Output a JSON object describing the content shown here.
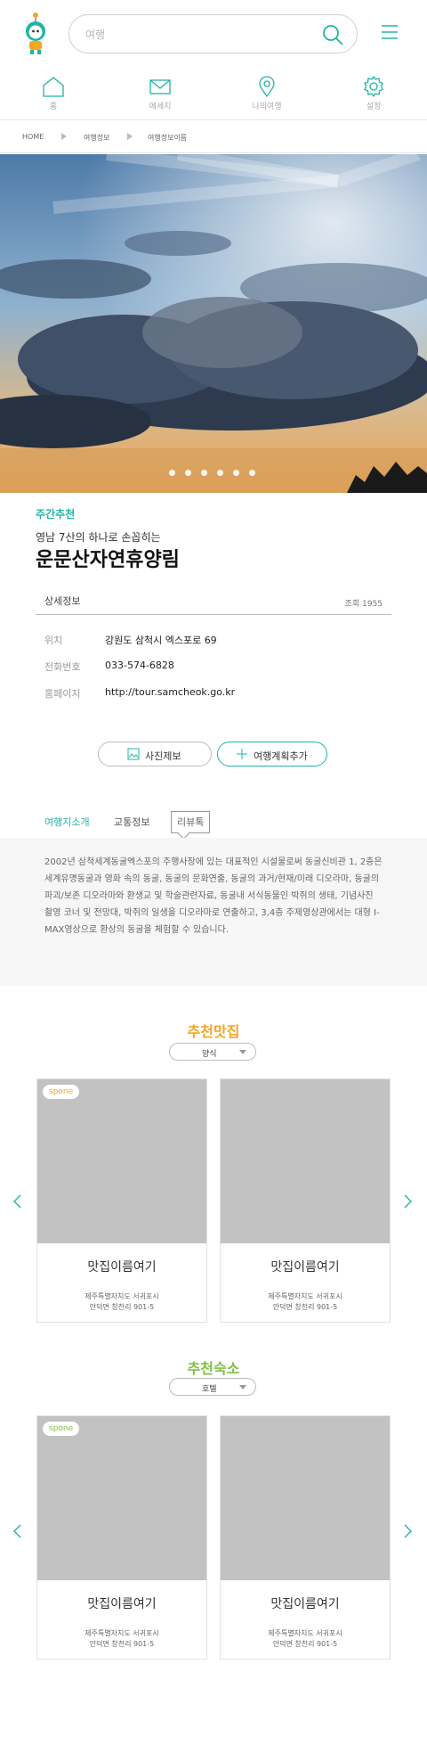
{
  "header": {
    "search_placeholder": "여행",
    "icons": {
      "mascot": "mascot-icon",
      "search": "search-icon",
      "menu": "menu-icon"
    }
  },
  "nav": [
    {
      "label": "홈",
      "icon": "home-icon"
    },
    {
      "label": "메세지",
      "icon": "mail-icon"
    },
    {
      "label": "나의여행",
      "icon": "location-pin-icon"
    },
    {
      "label": "설정",
      "icon": "gear-icon"
    }
  ],
  "breadcrumb": [
    "HOME",
    "여행정보",
    "여행정보이름"
  ],
  "hero": {
    "slide_count": 6,
    "active_slide": 0
  },
  "info": {
    "tag": "주간추천",
    "subtitle": "영남 7산의 하나로 손꼽히는",
    "title": "운문산자연휴양림",
    "detail_label": "상세정보",
    "views": "조회 1955",
    "rows": [
      {
        "key": "위치",
        "value": "강원도 삼척시 엑스포로 69"
      },
      {
        "key": "전화번호",
        "value": "033-574-6828"
      },
      {
        "key": "홈페이지",
        "value": "http://tour.samcheok.go.kr"
      }
    ]
  },
  "buttons": {
    "photo": "사진제보",
    "plan": "여행계획추가"
  },
  "tabs": [
    "여행지소개",
    "교통정보",
    "리뷰톡"
  ],
  "description": "2002년 삼척세계동굴엑스포의 주행사장에 있는 대표적인 시설물로써 동굴신비관 1, 2층은 세계유명동굴과 영화 속의 동굴, 동굴의 문화연출, 동굴의 과거/현재/미래 디오라마, 동굴의 파괴/보존 디오라마와 환생교 및 학술관련자료, 동굴내 서식동물인 박쥐의 생태, 기념사진 촬영 코너 및 전망대, 박쥐의 일생을 디오라마로 연출하고, 3,4층 주제영상관에서는 대형 I-MAX영상으로 환상의 동굴을 체험할 수 있습니다.",
  "restaurants": {
    "title": "추천맛집",
    "selected": "양식",
    "cards": [
      {
        "badge": "spone",
        "name": "맛집이름여기",
        "addr1": "제주특별자치도 서귀포시",
        "addr2": "안덕면 창천리 901-5"
      },
      {
        "badge": "",
        "name": "맛집이름여기",
        "addr1": "제주특별자치도 서귀포시",
        "addr2": "안덕면 창천리 901-5"
      }
    ]
  },
  "lodging": {
    "title": "추천숙소",
    "selected": "호텔",
    "cards": [
      {
        "badge": "spone",
        "name": "맛집이름여기",
        "addr1": "제주특별자치도 서귀포시",
        "addr2": "안덕면 창천리 901-5"
      },
      {
        "badge": "",
        "name": "맛집이름여기",
        "addr1": "제주특별자치도 서귀포시",
        "addr2": "안덕면 창천리 901-5"
      }
    ]
  },
  "colors": {
    "accent": "#1fb5a3",
    "restaurant_title": "#f5a623",
    "lodging_title": "#7cc242",
    "image_placeholder": "#c2c2c2"
  }
}
